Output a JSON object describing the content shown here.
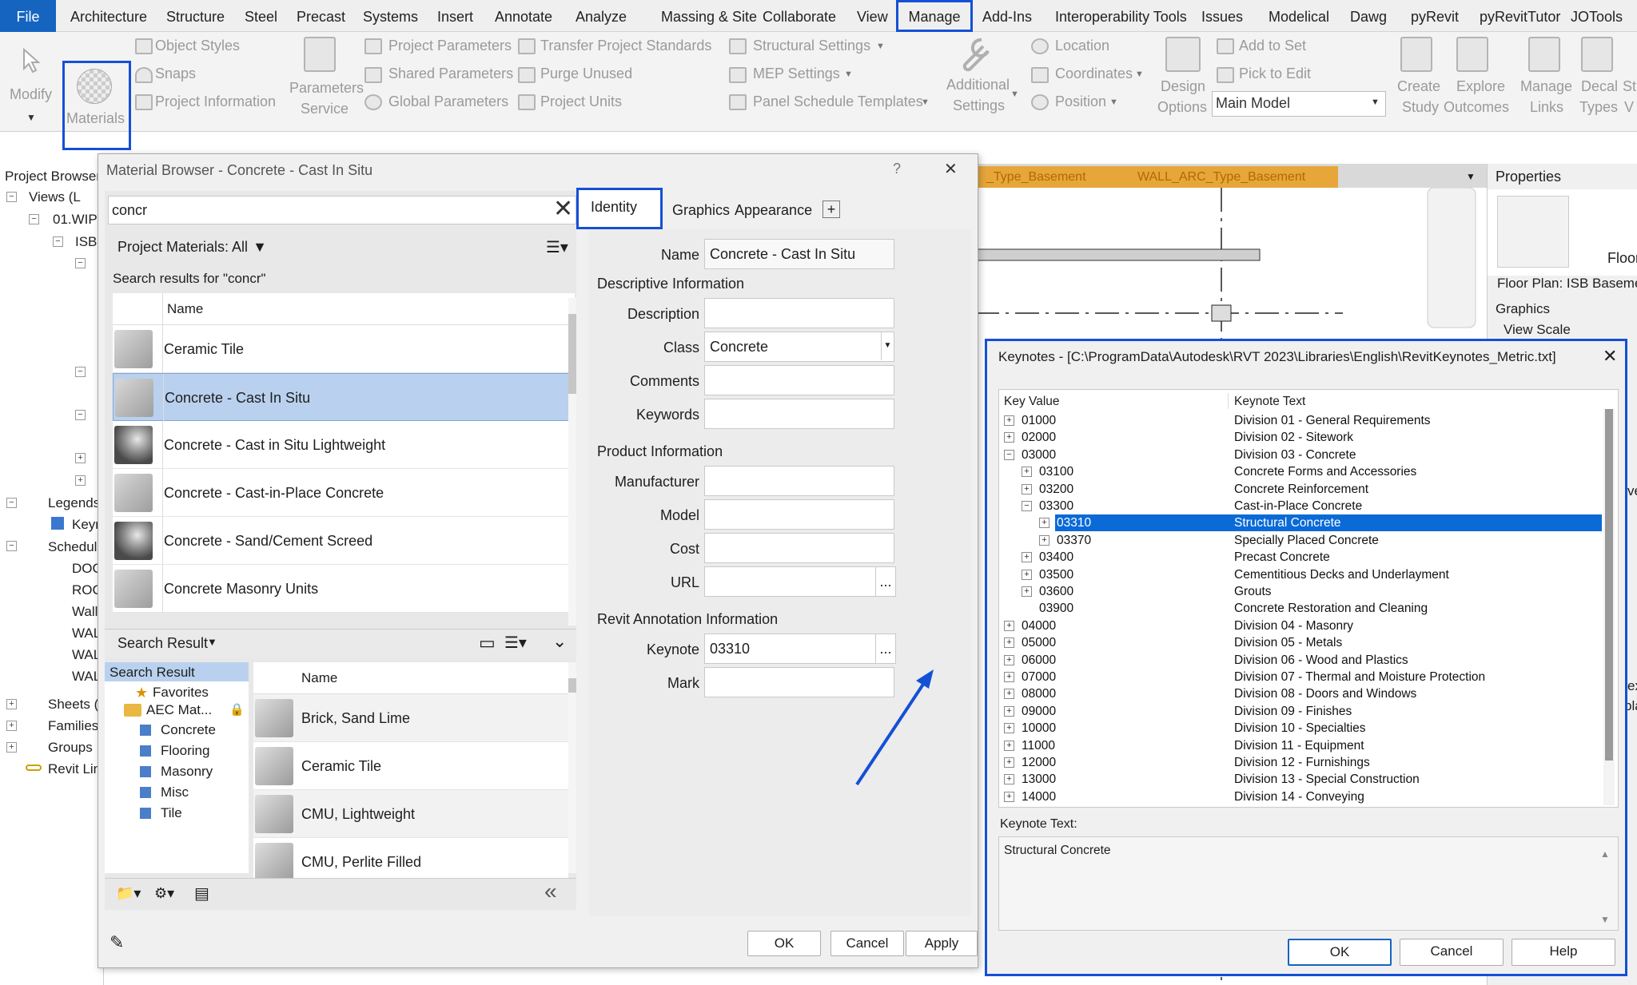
{
  "menu": {
    "file": "File",
    "items": [
      "Architecture",
      "Structure",
      "Steel",
      "Precast",
      "Systems",
      "Insert",
      "Annotate",
      "Analyze",
      "Massing & Site",
      "Collaborate",
      "View",
      "Manage",
      "Add-Ins",
      "Interoperability Tools",
      "Issues",
      "Modelical",
      "Dawg",
      "pyRevit",
      "pyRevitTutor",
      "JOTools"
    ],
    "active": "Manage"
  },
  "ribbon": {
    "modify": "Modify",
    "materials": "Materials",
    "object_styles": "Object  Styles",
    "snaps": "Snaps",
    "project_information": "Project  Information",
    "parameters_service_1": "Parameters",
    "parameters_service_2": "Service",
    "project_parameters": "Project  Parameters",
    "shared_parameters": "Shared  Parameters",
    "global_parameters": "Global  Parameters",
    "transfer_project_standards": "Transfer  Project Standards",
    "purge_unused": "Purge  Unused",
    "project_units": "Project  Units",
    "structural_settings": "Structural  Settings",
    "mep_settings": "MEP  Settings",
    "panel_schedule_templates": "Panel Schedule  Templates",
    "additional_settings_1": "Additional",
    "additional_settings_2": "Settings",
    "location": "Location",
    "coordinates": "Coordinates",
    "position": "Position",
    "design_options_1": "Design",
    "design_options_2": "Options",
    "add_to_set": "Add to Set",
    "pick_to_edit": "Pick to Edit",
    "main_model": "Main Model",
    "create_study_1": "Create",
    "create_study_2": "Study",
    "explore_outcomes_1": "Explore",
    "explore_outcomes_2": "Outcomes",
    "manage_links_1": "Manage",
    "manage_links_2": "Links",
    "decal_types_1": "Decal",
    "decal_types_2": "Types",
    "cut_1": "St",
    "cut_2": "V"
  },
  "project_browser": {
    "title": "Project Browser",
    "items": [
      "Views (L",
      "01.WIP",
      "ISB",
      "Legends",
      "Keyr",
      "Schedul",
      "DOC",
      "ROC",
      "Wall",
      "WAL",
      "WAL",
      "WAL",
      "Sheets (",
      "Families",
      "Groups",
      "Revit Lin"
    ]
  },
  "view_tabs": {
    "tab1": "_Type_Basement",
    "tab2": "WALL_ARC_Type_Basement"
  },
  "properties": {
    "title": "Properties",
    "type": "Floor Plan",
    "instance": "Floor Plan: ISB Baseme",
    "group": "Graphics",
    "row": "View Scale",
    "edge1": "ve",
    "edge2": "ex",
    "edge3": "pla"
  },
  "material_browser": {
    "title": "Material Browser - Concrete - Cast In Situ",
    "help": "?",
    "close": "✕",
    "search_value": "concr",
    "filter_label": "Project Materials: All",
    "results_label": "Search results for \"concr\"",
    "col_name": "Name",
    "materials": [
      {
        "name": "Ceramic Tile",
        "style": "cube"
      },
      {
        "name": "Concrete - Cast In Situ",
        "style": "cube"
      },
      {
        "name": "Concrete - Cast in Situ Lightweight",
        "style": "sphere"
      },
      {
        "name": "Concrete - Cast-in-Place Concrete",
        "style": "cube"
      },
      {
        "name": "Concrete - Sand/Cement Screed",
        "style": "sphere"
      },
      {
        "name": "Concrete Masonry Units",
        "style": "cmu"
      }
    ],
    "selected_material": "Concrete - Cast In Situ",
    "library_header": "Search Result",
    "tree": [
      "Search Result",
      "Favorites",
      "AEC Mat...",
      "Concrete",
      "Flooring",
      "Masonry",
      "Misc",
      "Tile"
    ],
    "library_col_name": "Name",
    "library_items": [
      "Brick, Sand Lime",
      "Ceramic Tile",
      "CMU, Lightweight",
      "CMU, Perlite Filled"
    ],
    "tabs": [
      "Identity",
      "Graphics",
      "Appearance"
    ],
    "add_tab": "+",
    "name_label": "Name",
    "name_value": "Concrete - Cast In Situ",
    "descriptive_header": "Descriptive Information",
    "description_label": "Description",
    "class_label": "Class",
    "class_value": "Concrete",
    "comments_label": "Comments",
    "keywords_label": "Keywords",
    "product_header": "Product Information",
    "manufacturer_label": "Manufacturer",
    "model_label": "Model",
    "cost_label": "Cost",
    "url_label": "URL",
    "annotation_header": "Revit Annotation Information",
    "keynote_label": "Keynote",
    "keynote_value": "03310",
    "mark_label": "Mark",
    "browse_dots": "...",
    "collapse": "«",
    "ok": "OK",
    "cancel": "Cancel",
    "apply": "Apply"
  },
  "keynotes": {
    "title": "Keynotes - [C:\\ProgramData\\Autodesk\\RVT 2023\\Libraries\\English\\RevitKeynotes_Metric.txt]",
    "close": "✕",
    "col_key": "Key Value",
    "col_text": "Keynote Text",
    "rows": [
      {
        "key": "01000",
        "text": "Division 01 - General Requirements",
        "level": 0,
        "toggle": "+"
      },
      {
        "key": "02000",
        "text": "Division 02 - Sitework",
        "level": 0,
        "toggle": "+"
      },
      {
        "key": "03000",
        "text": "Division 03 - Concrete",
        "level": 0,
        "toggle": "−"
      },
      {
        "key": "03100",
        "text": "Concrete Forms and Accessories",
        "level": 1,
        "toggle": "+"
      },
      {
        "key": "03200",
        "text": "Concrete Reinforcement",
        "level": 1,
        "toggle": "+"
      },
      {
        "key": "03300",
        "text": "Cast-in-Place Concrete",
        "level": 1,
        "toggle": "−"
      },
      {
        "key": "03310",
        "text": "Structural Concrete",
        "level": 2,
        "toggle": "+",
        "selected": true
      },
      {
        "key": "03370",
        "text": "Specially Placed Concrete",
        "level": 2,
        "toggle": "+"
      },
      {
        "key": "03400",
        "text": "Precast Concrete",
        "level": 1,
        "toggle": "+"
      },
      {
        "key": "03500",
        "text": "Cementitious Decks and Underlayment",
        "level": 1,
        "toggle": "+"
      },
      {
        "key": "03600",
        "text": "Grouts",
        "level": 1,
        "toggle": "+"
      },
      {
        "key": "03900",
        "text": "Concrete Restoration and Cleaning",
        "level": 1,
        "toggle": ""
      },
      {
        "key": "04000",
        "text": "Division 04 - Masonry",
        "level": 0,
        "toggle": "+"
      },
      {
        "key": "05000",
        "text": "Division 05 - Metals",
        "level": 0,
        "toggle": "+"
      },
      {
        "key": "06000",
        "text": "Division 06 - Wood and Plastics",
        "level": 0,
        "toggle": "+"
      },
      {
        "key": "07000",
        "text": "Division 07 - Thermal and Moisture Protection",
        "level": 0,
        "toggle": "+"
      },
      {
        "key": "08000",
        "text": "Division 08 - Doors and Windows",
        "level": 0,
        "toggle": "+"
      },
      {
        "key": "09000",
        "text": "Division 09 - Finishes",
        "level": 0,
        "toggle": "+"
      },
      {
        "key": "10000",
        "text": "Division 10 - Specialties",
        "level": 0,
        "toggle": "+"
      },
      {
        "key": "11000",
        "text": "Division 11 - Equipment",
        "level": 0,
        "toggle": "+"
      },
      {
        "key": "12000",
        "text": "Division 12 - Furnishings",
        "level": 0,
        "toggle": "+"
      },
      {
        "key": "13000",
        "text": "Division 13 - Special Construction",
        "level": 0,
        "toggle": "+"
      },
      {
        "key": "14000",
        "text": "Division 14 - Conveying",
        "level": 0,
        "toggle": "+"
      }
    ],
    "keynote_text_label": "Keynote Text:",
    "keynote_text_value": "Structural Concrete",
    "ok": "OK",
    "cancel": "Cancel",
    "help": "Help"
  },
  "colors": {
    "highlight_outline": "#1450d6",
    "selection": "#0a6ad6",
    "file_tab": "#1565c0",
    "view_tab": "#e6a63a"
  }
}
